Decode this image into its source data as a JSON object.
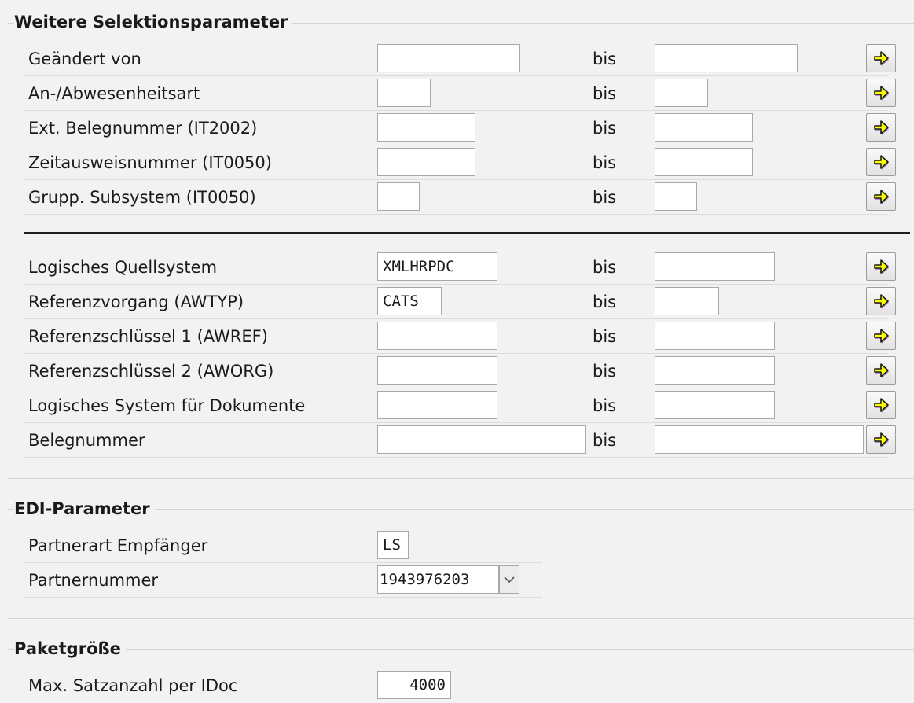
{
  "groups": {
    "selection": "Weitere Selektionsparameter",
    "edi": "EDI-Parameter",
    "paket": "Paketgröße"
  },
  "bis_label": "bis",
  "rows": [
    {
      "label": "Geändert von",
      "low": "",
      "high": ""
    },
    {
      "label": "An-/Abwesenheitsart",
      "low": "",
      "high": ""
    },
    {
      "label": "Ext. Belegnummer (IT2002)",
      "low": "",
      "high": ""
    },
    {
      "label": "Zeitausweisnummer (IT0050)",
      "low": "",
      "high": ""
    },
    {
      "label": "Grupp. Subsystem (IT0050)",
      "low": "",
      "high": ""
    },
    {
      "label": "Logisches Quellsystem",
      "low": "XMLHRPDC",
      "high": ""
    },
    {
      "label": "Referenzvorgang (AWTYP)",
      "low": "CATS",
      "high": ""
    },
    {
      "label": "Referenzschlüssel 1 (AWREF)",
      "low": "",
      "high": ""
    },
    {
      "label": "Referenzschlüssel 2 (AWORG)",
      "low": "",
      "high": ""
    },
    {
      "label": "Logisches System für Dokumente",
      "low": "",
      "high": ""
    },
    {
      "label": "Belegnummer",
      "low": "",
      "high": ""
    }
  ],
  "edi": {
    "partnerart_label": "Partnerart Empfänger",
    "partnerart_value": "LS",
    "partnernummer_label": "Partnernummer",
    "partnernummer_value": "1943976203"
  },
  "paket": {
    "label": "Max. Satzanzahl per IDoc",
    "value": "4000"
  },
  "icons": {
    "multiple_selection": "arrow-right-icon",
    "dropdown": "chevron-down-icon"
  },
  "colors": {
    "arrow_fill": "#ffff00",
    "arrow_stroke": "#1a1a1a",
    "arrow_shadow": "#b48ec8"
  }
}
